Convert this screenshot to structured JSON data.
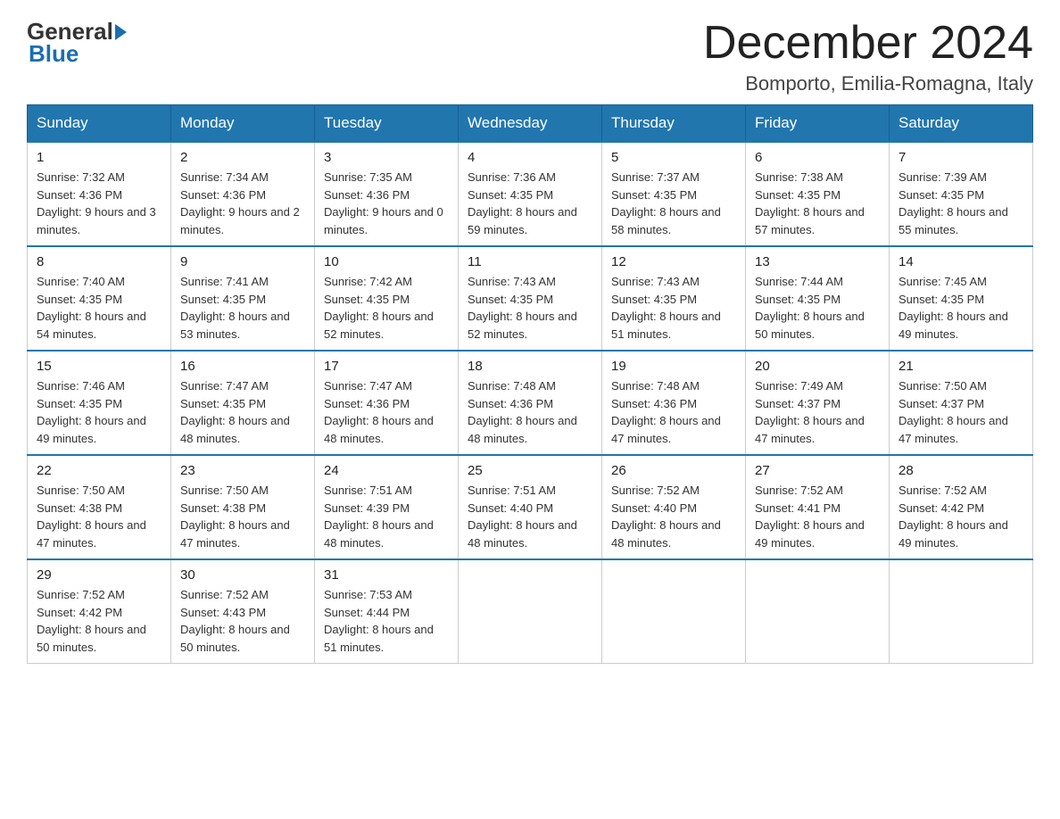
{
  "header": {
    "logo_general": "General",
    "logo_blue": "Blue",
    "month_title": "December 2024",
    "location": "Bomporto, Emilia-Romagna, Italy"
  },
  "days_of_week": [
    "Sunday",
    "Monday",
    "Tuesday",
    "Wednesday",
    "Thursday",
    "Friday",
    "Saturday"
  ],
  "weeks": [
    [
      {
        "day": "1",
        "sunrise": "Sunrise: 7:32 AM",
        "sunset": "Sunset: 4:36 PM",
        "daylight": "Daylight: 9 hours and 3 minutes."
      },
      {
        "day": "2",
        "sunrise": "Sunrise: 7:34 AM",
        "sunset": "Sunset: 4:36 PM",
        "daylight": "Daylight: 9 hours and 2 minutes."
      },
      {
        "day": "3",
        "sunrise": "Sunrise: 7:35 AM",
        "sunset": "Sunset: 4:36 PM",
        "daylight": "Daylight: 9 hours and 0 minutes."
      },
      {
        "day": "4",
        "sunrise": "Sunrise: 7:36 AM",
        "sunset": "Sunset: 4:35 PM",
        "daylight": "Daylight: 8 hours and 59 minutes."
      },
      {
        "day": "5",
        "sunrise": "Sunrise: 7:37 AM",
        "sunset": "Sunset: 4:35 PM",
        "daylight": "Daylight: 8 hours and 58 minutes."
      },
      {
        "day": "6",
        "sunrise": "Sunrise: 7:38 AM",
        "sunset": "Sunset: 4:35 PM",
        "daylight": "Daylight: 8 hours and 57 minutes."
      },
      {
        "day": "7",
        "sunrise": "Sunrise: 7:39 AM",
        "sunset": "Sunset: 4:35 PM",
        "daylight": "Daylight: 8 hours and 55 minutes."
      }
    ],
    [
      {
        "day": "8",
        "sunrise": "Sunrise: 7:40 AM",
        "sunset": "Sunset: 4:35 PM",
        "daylight": "Daylight: 8 hours and 54 minutes."
      },
      {
        "day": "9",
        "sunrise": "Sunrise: 7:41 AM",
        "sunset": "Sunset: 4:35 PM",
        "daylight": "Daylight: 8 hours and 53 minutes."
      },
      {
        "day": "10",
        "sunrise": "Sunrise: 7:42 AM",
        "sunset": "Sunset: 4:35 PM",
        "daylight": "Daylight: 8 hours and 52 minutes."
      },
      {
        "day": "11",
        "sunrise": "Sunrise: 7:43 AM",
        "sunset": "Sunset: 4:35 PM",
        "daylight": "Daylight: 8 hours and 52 minutes."
      },
      {
        "day": "12",
        "sunrise": "Sunrise: 7:43 AM",
        "sunset": "Sunset: 4:35 PM",
        "daylight": "Daylight: 8 hours and 51 minutes."
      },
      {
        "day": "13",
        "sunrise": "Sunrise: 7:44 AM",
        "sunset": "Sunset: 4:35 PM",
        "daylight": "Daylight: 8 hours and 50 minutes."
      },
      {
        "day": "14",
        "sunrise": "Sunrise: 7:45 AM",
        "sunset": "Sunset: 4:35 PM",
        "daylight": "Daylight: 8 hours and 49 minutes."
      }
    ],
    [
      {
        "day": "15",
        "sunrise": "Sunrise: 7:46 AM",
        "sunset": "Sunset: 4:35 PM",
        "daylight": "Daylight: 8 hours and 49 minutes."
      },
      {
        "day": "16",
        "sunrise": "Sunrise: 7:47 AM",
        "sunset": "Sunset: 4:35 PM",
        "daylight": "Daylight: 8 hours and 48 minutes."
      },
      {
        "day": "17",
        "sunrise": "Sunrise: 7:47 AM",
        "sunset": "Sunset: 4:36 PM",
        "daylight": "Daylight: 8 hours and 48 minutes."
      },
      {
        "day": "18",
        "sunrise": "Sunrise: 7:48 AM",
        "sunset": "Sunset: 4:36 PM",
        "daylight": "Daylight: 8 hours and 48 minutes."
      },
      {
        "day": "19",
        "sunrise": "Sunrise: 7:48 AM",
        "sunset": "Sunset: 4:36 PM",
        "daylight": "Daylight: 8 hours and 47 minutes."
      },
      {
        "day": "20",
        "sunrise": "Sunrise: 7:49 AM",
        "sunset": "Sunset: 4:37 PM",
        "daylight": "Daylight: 8 hours and 47 minutes."
      },
      {
        "day": "21",
        "sunrise": "Sunrise: 7:50 AM",
        "sunset": "Sunset: 4:37 PM",
        "daylight": "Daylight: 8 hours and 47 minutes."
      }
    ],
    [
      {
        "day": "22",
        "sunrise": "Sunrise: 7:50 AM",
        "sunset": "Sunset: 4:38 PM",
        "daylight": "Daylight: 8 hours and 47 minutes."
      },
      {
        "day": "23",
        "sunrise": "Sunrise: 7:50 AM",
        "sunset": "Sunset: 4:38 PM",
        "daylight": "Daylight: 8 hours and 47 minutes."
      },
      {
        "day": "24",
        "sunrise": "Sunrise: 7:51 AM",
        "sunset": "Sunset: 4:39 PM",
        "daylight": "Daylight: 8 hours and 48 minutes."
      },
      {
        "day": "25",
        "sunrise": "Sunrise: 7:51 AM",
        "sunset": "Sunset: 4:40 PM",
        "daylight": "Daylight: 8 hours and 48 minutes."
      },
      {
        "day": "26",
        "sunrise": "Sunrise: 7:52 AM",
        "sunset": "Sunset: 4:40 PM",
        "daylight": "Daylight: 8 hours and 48 minutes."
      },
      {
        "day": "27",
        "sunrise": "Sunrise: 7:52 AM",
        "sunset": "Sunset: 4:41 PM",
        "daylight": "Daylight: 8 hours and 49 minutes."
      },
      {
        "day": "28",
        "sunrise": "Sunrise: 7:52 AM",
        "sunset": "Sunset: 4:42 PM",
        "daylight": "Daylight: 8 hours and 49 minutes."
      }
    ],
    [
      {
        "day": "29",
        "sunrise": "Sunrise: 7:52 AM",
        "sunset": "Sunset: 4:42 PM",
        "daylight": "Daylight: 8 hours and 50 minutes."
      },
      {
        "day": "30",
        "sunrise": "Sunrise: 7:52 AM",
        "sunset": "Sunset: 4:43 PM",
        "daylight": "Daylight: 8 hours and 50 minutes."
      },
      {
        "day": "31",
        "sunrise": "Sunrise: 7:53 AM",
        "sunset": "Sunset: 4:44 PM",
        "daylight": "Daylight: 8 hours and 51 minutes."
      },
      null,
      null,
      null,
      null
    ]
  ]
}
